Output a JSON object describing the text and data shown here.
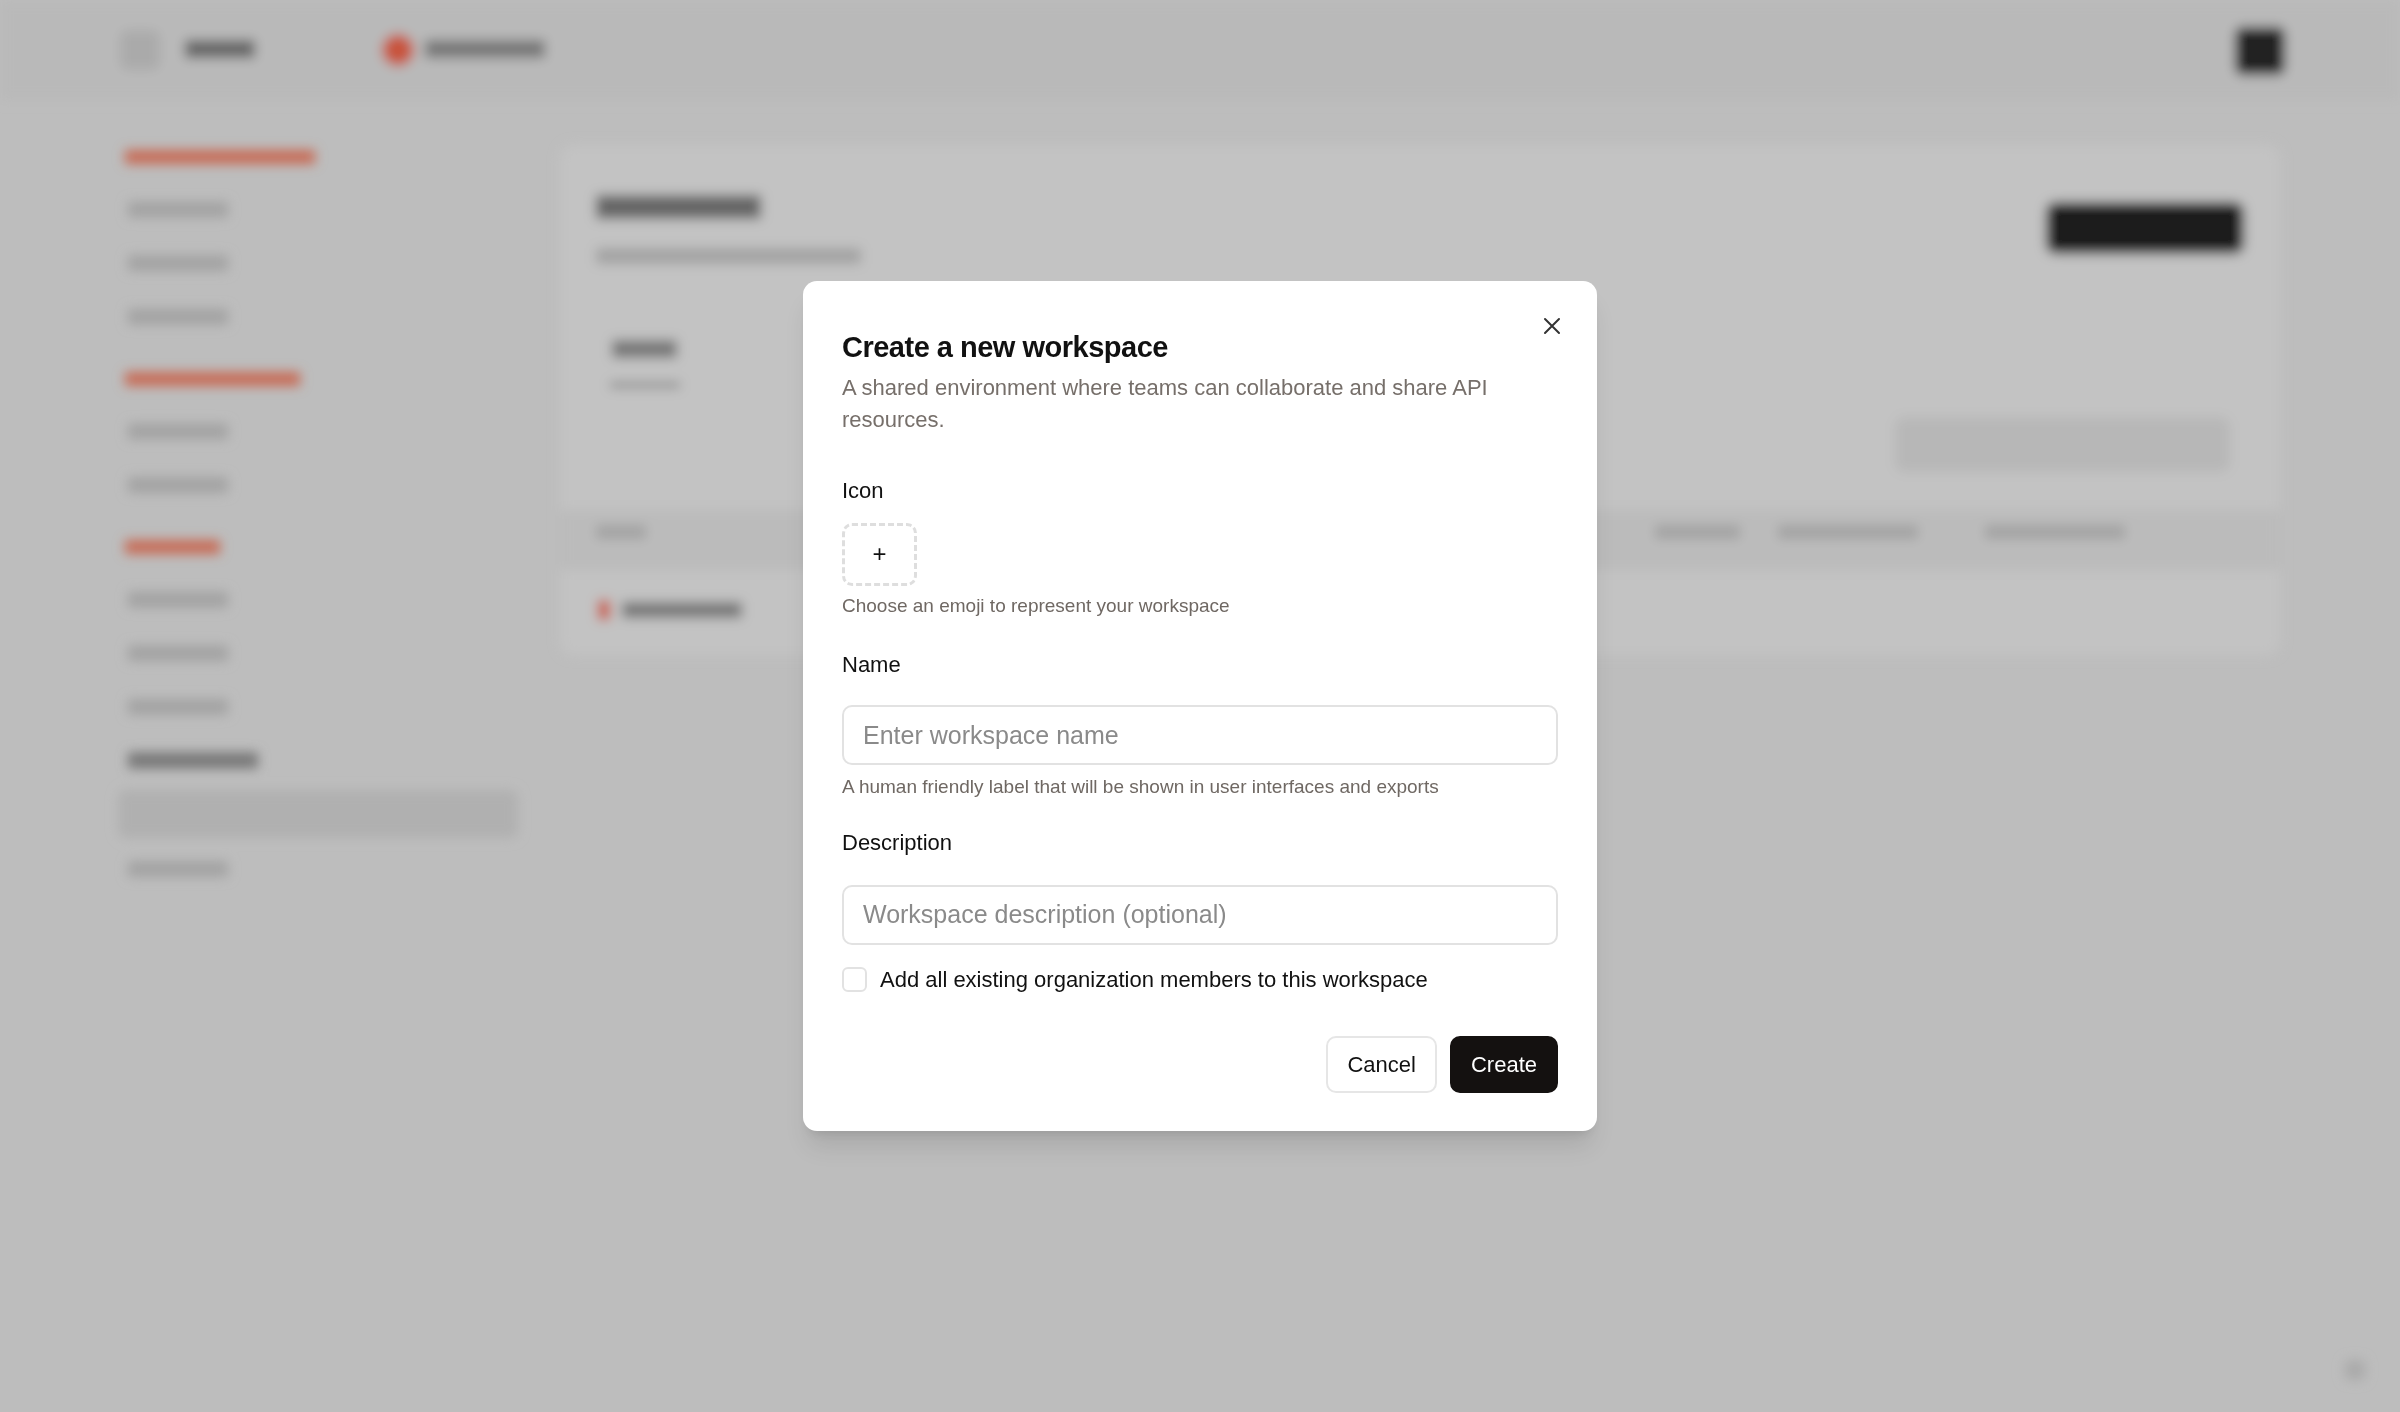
{
  "dialog": {
    "title": "Create a new workspace",
    "description": "A shared environment where teams can collaborate and share API resources.",
    "icon_field": {
      "label": "Icon",
      "button": "+",
      "hint": "Choose an emoji to represent your workspace"
    },
    "name_field": {
      "label": "Name",
      "placeholder": "Enter workspace name",
      "hint": "A human friendly label that will be shown in user interfaces and exports"
    },
    "description_field": {
      "label": "Description",
      "placeholder": "Workspace description (optional)"
    },
    "add_members": {
      "label": "Add all existing organization members to this workspace",
      "checked": false
    },
    "buttons": [
      {
        "label": "Cancel",
        "kind": "secondary"
      },
      {
        "label": "Create",
        "kind": "primary"
      }
    ]
  }
}
